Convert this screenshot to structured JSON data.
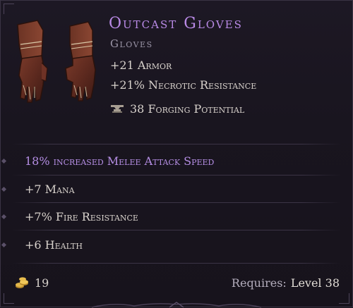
{
  "item": {
    "name": "Outcast Gloves",
    "type": "Gloves",
    "base_stats": [
      "+21 Armor",
      "+21% Necrotic Resistance"
    ],
    "forging_potential": "38 Forging Potential"
  },
  "mods": [
    {
      "text": "18% increased Melee Attack Speed"
    },
    {
      "text": "+7 Mana"
    },
    {
      "text": "+7% Fire Resistance"
    },
    {
      "text": "+6 Health"
    }
  ],
  "footer": {
    "gold": "19",
    "requires_label": "Requires:",
    "requires_value": "Level 38"
  },
  "icons": {
    "item": "leather-gloves-icon",
    "forging": "anvil-icon",
    "gold": "gold-coins-icon"
  },
  "colors": {
    "title": "#b98ae6",
    "highlight_mod": "#b58ee4",
    "text": "#d8d2cc",
    "background": "#1b1621"
  }
}
